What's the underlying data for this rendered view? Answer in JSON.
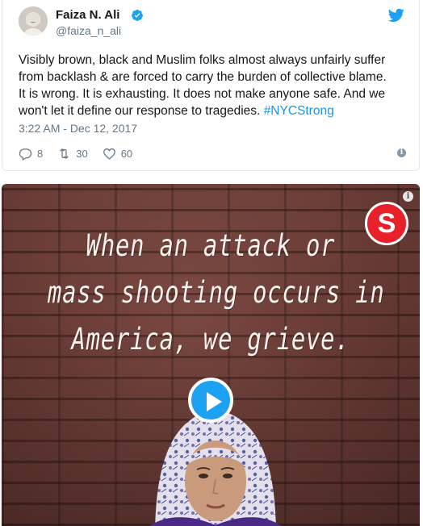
{
  "tweet": {
    "author_name": "Faiza N. Ali",
    "handle": "@faiza_n_ali",
    "text_lines": [
      "Visibly brown, black and Muslim folks almost always unfairly suffer",
      "from backlash & are forced to carry the burden of collective blame.",
      "It is wrong. It is exhausting. It does not make anyone safe. And we",
      "won't let it define our response to tragedies. "
    ],
    "hashtag": "#NYCStrong",
    "timestamp": "3:22 AM - Dec 12, 2017",
    "reply_count": "8",
    "retweet_count": "30",
    "like_count": "60",
    "info_glyph": "i"
  },
  "media": {
    "overlay_lines": [
      "When an attack or",
      "mass shooting occurs in",
      "America, we grieve."
    ],
    "logo_letter": "S",
    "info_glyph": "i"
  },
  "colors": {
    "link": "#1b95e0",
    "twitter_blue": "#1da1f2",
    "muted": "#657786",
    "logo_red": "#e8202a",
    "brick": "#74403a"
  },
  "icons": {
    "verified": "verified-badge-icon",
    "bird": "twitter-bird-icon",
    "reply": "reply-icon",
    "retweet": "retweet-icon",
    "like": "heart-icon",
    "info": "info-icon",
    "play": "play-icon"
  }
}
